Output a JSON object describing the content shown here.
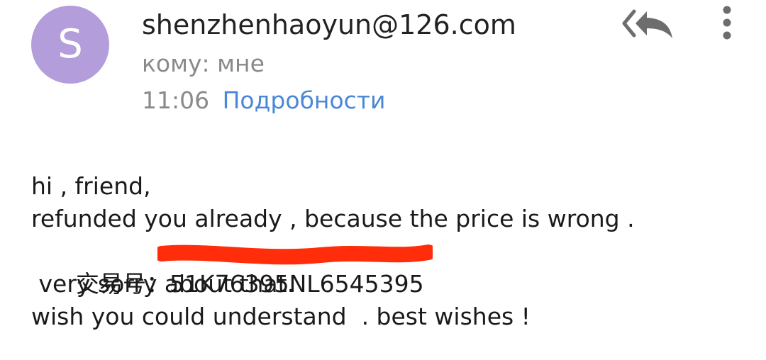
{
  "header": {
    "avatar_letter": "S",
    "avatar_color": "#b39ddb",
    "sender": "shenzhenhaoyun@126.com",
    "recipient": "кому: мне",
    "time": "11:06",
    "details_link": "Подробности",
    "link_color": "#4a87d6",
    "icons": [
      "reply-all-icon",
      "more-vertical-icon"
    ]
  },
  "message": {
    "lines": [
      "hi , friend,",
      "refunded you already , because the price is wrong .",
      "交易号：51K76395NL6545395",
      " very sorry about that.",
      "wish you could understand  . best wishes !"
    ],
    "redaction_color": "#ff2d0a"
  }
}
